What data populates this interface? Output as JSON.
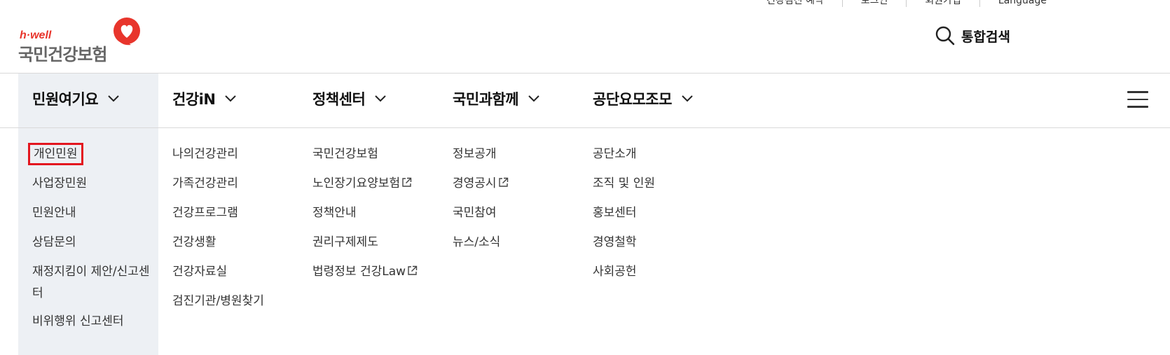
{
  "util_links": [
    "건강검진 예약",
    "로그인",
    "회원가입",
    "Language"
  ],
  "logo": {
    "small": "h·well",
    "main": "국민건강보험"
  },
  "search": {
    "label": "통합검색"
  },
  "nav": [
    {
      "label": "민원여기요",
      "items": [
        "개인민원",
        "사업장민원",
        "민원안내",
        "상담문의",
        "재정지킴이 제안/신고센터",
        "비위행위 신고센터"
      ]
    },
    {
      "label": "건강iN",
      "items": [
        "나의건강관리",
        "가족건강관리",
        "건강프로그램",
        "건강생활",
        "건강자료실",
        "검진기관/병원찾기"
      ]
    },
    {
      "label": "정책센터",
      "items": [
        "국민건강보험",
        "노인장기요양보험",
        "정책안내",
        "권리구제제도",
        "법령정보 건강Law"
      ]
    },
    {
      "label": "국민과함께",
      "items": [
        "정보공개",
        "경영공시",
        "국민참여",
        "뉴스/소식"
      ]
    },
    {
      "label": "공단요모조모",
      "items": [
        "공단소개",
        "조직 및 인원",
        "홍보센터",
        "경영철학",
        "사회공헌"
      ]
    }
  ],
  "external_link_items": [
    "노인장기요양보험",
    "법령정보 건강Law",
    "경영공시"
  ],
  "highlighted_item": "개인민원",
  "icons": {
    "search": "search-icon",
    "menu": "hamburger-menu-icon",
    "chevron": "chevron-down-icon",
    "external": "external-link-icon"
  },
  "colors": {
    "brand_red": "#e8352c",
    "highlight_border": "#e3161f",
    "active_bg": "#edf0f4"
  }
}
